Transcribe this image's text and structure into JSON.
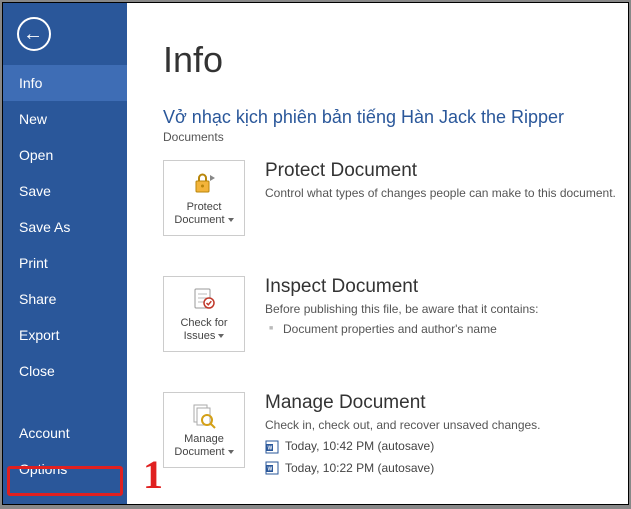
{
  "sidebar": {
    "items": [
      {
        "label": "Info",
        "active": true
      },
      {
        "label": "New"
      },
      {
        "label": "Open"
      },
      {
        "label": "Save"
      },
      {
        "label": "Save As"
      },
      {
        "label": "Print"
      },
      {
        "label": "Share"
      },
      {
        "label": "Export"
      },
      {
        "label": "Close"
      }
    ],
    "account": "Account",
    "options": "Options"
  },
  "annotation": {
    "number": "1"
  },
  "heading": "Info",
  "document": {
    "title": "Vở nhạc kịch phiên bản tiếng Hàn Jack the Ripper",
    "location": "Documents"
  },
  "protect": {
    "tile": "Protect Document",
    "title": "Protect Document",
    "desc": "Control what types of changes people can make to this document."
  },
  "inspect": {
    "tile": "Check for Issues",
    "title": "Inspect Document",
    "desc": "Before publishing this file, be aware that it contains:",
    "items": [
      "Document properties and author's name"
    ]
  },
  "manage": {
    "tile": "Manage Document",
    "title": "Manage Document",
    "desc": "Check in, check out, and recover unsaved changes.",
    "versions": [
      "Today, 10:42 PM (autosave)",
      "Today, 10:22 PM (autosave)"
    ]
  }
}
